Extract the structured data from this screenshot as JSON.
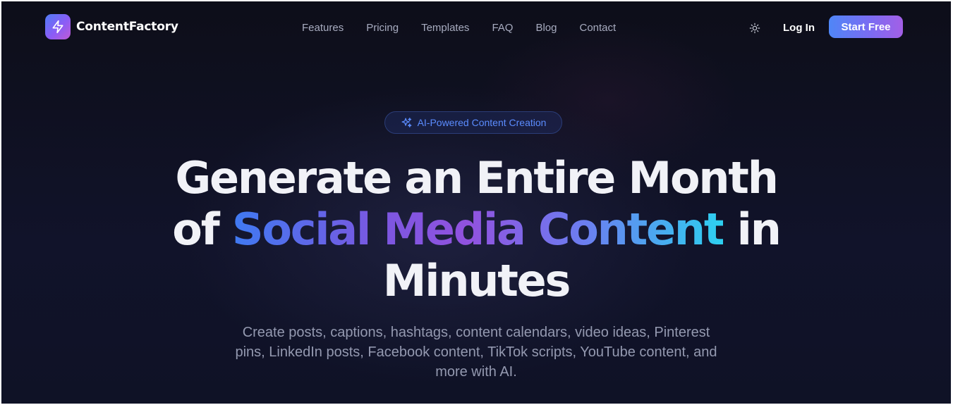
{
  "brand": {
    "name": "ContentFactory",
    "logo_icon": "lightning-bolt-icon"
  },
  "nav": {
    "links": [
      "Features",
      "Pricing",
      "Templates",
      "FAQ",
      "Blog",
      "Contact"
    ],
    "theme_toggle_icon": "sun-icon",
    "login_label": "Log In",
    "cta_label": "Start Free"
  },
  "hero": {
    "badge_icon": "sparkles-icon",
    "badge_text": "AI-Powered Content Creation",
    "headline_line1": "Generate an Entire Month",
    "headline_pre": "of ",
    "headline_highlight": "Social Media Content",
    "headline_post": " in",
    "headline_line3": "Minutes",
    "subtitle": "Create posts, captions, hashtags, content calendars, video ideas, Pinterest pins, LinkedIn posts, Facebook content, TikTok scripts, YouTube content, and more with AI."
  },
  "colors": {
    "background": "#0f1024",
    "accent_blue": "#4f86f7",
    "accent_purple": "#8b5cf6",
    "accent_cyan": "#2dd0f0",
    "badge_text": "#5b8cff",
    "muted_text": "#9499b0"
  }
}
